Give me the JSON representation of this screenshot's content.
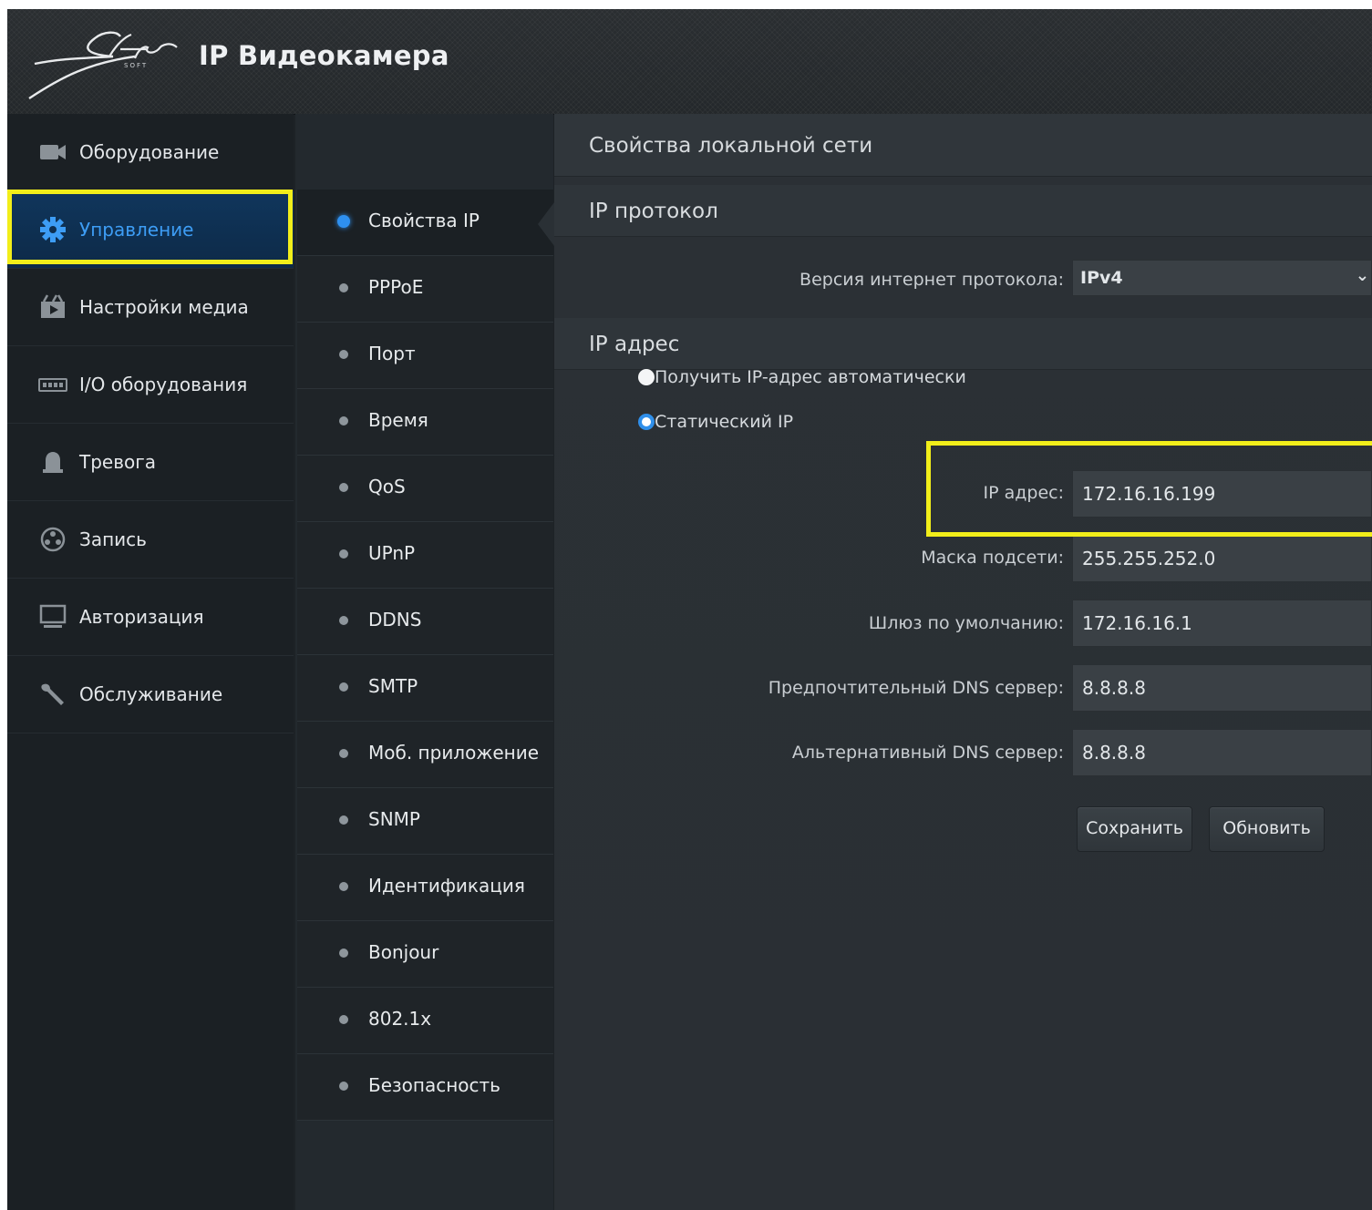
{
  "header": {
    "title": "IP Видеокамера"
  },
  "sidebar": {
    "items": [
      {
        "label": "Оборудование",
        "icon": "camera-icon"
      },
      {
        "label": "Управление",
        "icon": "gear-icon",
        "active": true
      },
      {
        "label": "Настройки медиа",
        "icon": "media-icon"
      },
      {
        "label": "I/O оборудования",
        "icon": "io-icon"
      },
      {
        "label": "Тревога",
        "icon": "alarm-icon"
      },
      {
        "label": "Запись",
        "icon": "record-icon"
      },
      {
        "label": "Авторизация",
        "icon": "monitor-icon"
      },
      {
        "label": "Обслуживание",
        "icon": "wrench-icon"
      }
    ]
  },
  "submenu": {
    "items": [
      {
        "label": "Свойства IP",
        "active": true
      },
      {
        "label": "PPPoE"
      },
      {
        "label": "Порт"
      },
      {
        "label": "Время"
      },
      {
        "label": "QoS"
      },
      {
        "label": "UPnP"
      },
      {
        "label": "DDNS"
      },
      {
        "label": "SMTP"
      },
      {
        "label": "Моб. приложение"
      },
      {
        "label": "SNMP"
      },
      {
        "label": "Идентификация"
      },
      {
        "label": "Bonjour"
      },
      {
        "label": "802.1x"
      },
      {
        "label": "Безопасность"
      }
    ]
  },
  "main": {
    "title": "Свойства локальной сети",
    "protocol_section": {
      "title": "IP протокол",
      "version_label": "Версия интернет протокола:",
      "version_value": "IPv4"
    },
    "address_section": {
      "title": "IP адрес",
      "radio_auto": "Получить IP-адрес автоматически",
      "radio_static": "Статический IP",
      "selected": "static",
      "fields": {
        "ip_label": "IP адрес:",
        "ip_value": "172.16.16.199",
        "mask_label": "Маска подсети:",
        "mask_value": "255.255.252.0",
        "gateway_label": "Шлюз по умолчанию:",
        "gateway_value": "172.16.16.1",
        "dns1_label": "Предпочтительный DNS сервер:",
        "dns1_value": "8.8.8.8",
        "dns2_label": "Альтернативный DNS сервер:",
        "dns2_value": "8.8.8.8"
      }
    },
    "buttons": {
      "save": "Сохранить",
      "refresh": "Обновить"
    }
  },
  "colors": {
    "accent": "#2e90f0",
    "highlight": "#f2ee1a",
    "active_bg": "#10365c"
  }
}
